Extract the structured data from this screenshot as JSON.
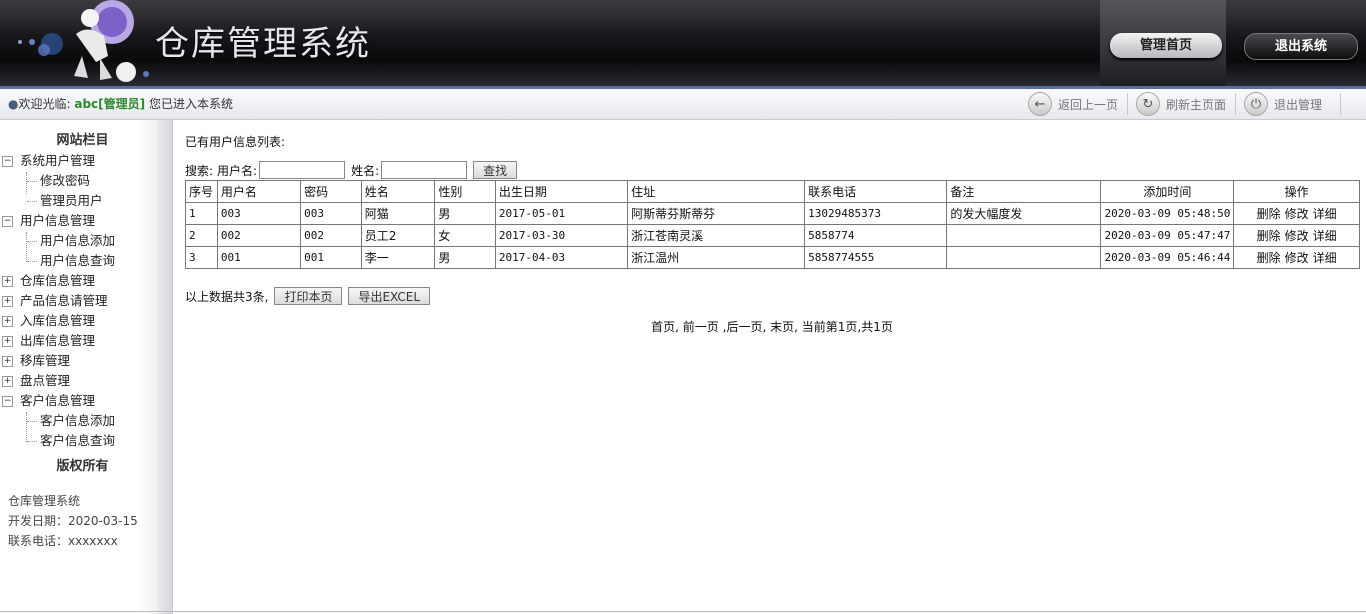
{
  "app": {
    "title": "仓库管理系统"
  },
  "header": {
    "home_button": "管理首页",
    "exit_button": "退出系统"
  },
  "subbar": {
    "welcome_prefix": "欢迎光临:",
    "user": "abc[管理员]",
    "welcome_suffix": "您已进入本系统",
    "back": "返回上一页",
    "refresh": "刷新主页面",
    "logout": "退出管理"
  },
  "sidebar": {
    "title": "网站栏目",
    "groups": [
      {
        "label": "系统用户管理",
        "expanded": true,
        "children": [
          "修改密码",
          "管理员用户"
        ]
      },
      {
        "label": "用户信息管理",
        "expanded": true,
        "children": [
          "用户信息添加",
          "用户信息查询"
        ]
      },
      {
        "label": "仓库信息管理",
        "expanded": false,
        "children": []
      },
      {
        "label": "产品信息请管理",
        "expanded": false,
        "children": []
      },
      {
        "label": "入库信息管理",
        "expanded": false,
        "children": []
      },
      {
        "label": "出库信息管理",
        "expanded": false,
        "children": []
      },
      {
        "label": "移库管理",
        "expanded": false,
        "children": []
      },
      {
        "label": "盘点管理",
        "expanded": false,
        "children": []
      },
      {
        "label": "客户信息管理",
        "expanded": true,
        "children": [
          "客户信息添加",
          "客户信息查询"
        ]
      }
    ],
    "copyright_title": "版权所有",
    "info": [
      "仓库管理系统",
      "开发日期：2020-03-15",
      "联系电话：xxxxxxx"
    ]
  },
  "main": {
    "list_title": "已有用户信息列表:",
    "search": {
      "label": "搜索:",
      "username_label": "用户名:",
      "name_label": "姓名:",
      "username_value": "",
      "name_value": "",
      "button": "查找"
    },
    "columns": [
      "序号",
      "用户名",
      "密码",
      "姓名",
      "性别",
      "出生日期",
      "住址",
      "联系电话",
      "备注",
      "添加时间",
      "操作"
    ],
    "rows": [
      [
        "1",
        "003",
        "003",
        "阿猫",
        "男",
        "2017-05-01",
        "阿斯蒂芬斯蒂芬",
        "13029485373",
        "的发大幅度发",
        "2020-03-09 05:48:50"
      ],
      [
        "2",
        "002",
        "002",
        "员工2",
        "女",
        "2017-03-30",
        "浙江苍南灵溪",
        "5858774",
        "",
        "2020-03-09 05:47:47"
      ],
      [
        "3",
        "001",
        "001",
        "李一",
        "男",
        "2017-04-03",
        "浙江温州",
        "5858774555",
        "",
        "2020-03-09 05:46:44"
      ]
    ],
    "row_actions": [
      "删除",
      "修改",
      "详细"
    ],
    "summary_text": "以上数据共3条,",
    "print_button": "打印本页",
    "export_button": "导出EXCEL",
    "pager": {
      "first": "首页,",
      "prev": "前一页",
      "next": ",后一页,",
      "last": "末页,",
      "current": "当前第1页,共1页"
    }
  }
}
